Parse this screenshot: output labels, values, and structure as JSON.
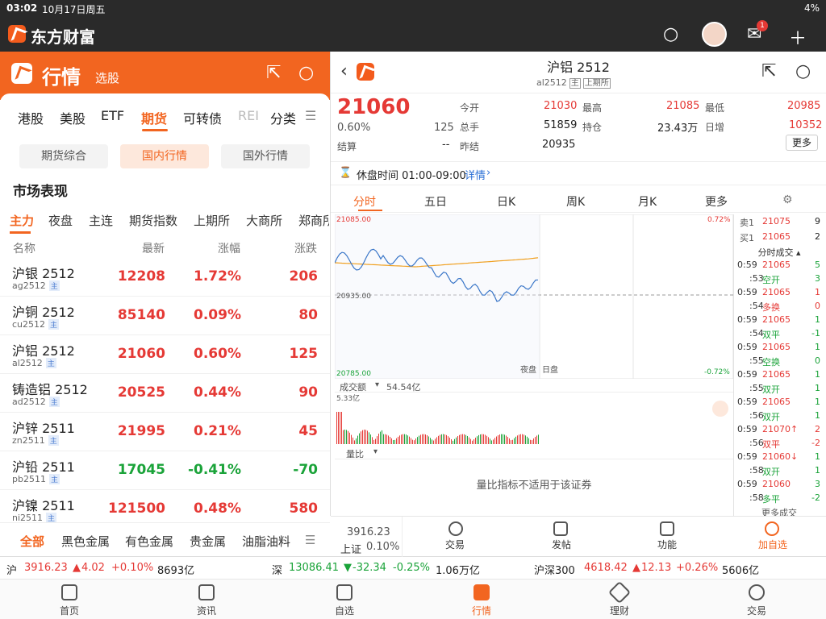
{
  "status": {
    "time": "03:02",
    "date": "10月17日周五",
    "battery": "4%"
  },
  "app": {
    "title": "东方财富",
    "mail_badge": "1"
  },
  "left": {
    "header_title": "行情",
    "header_sub": "选股",
    "tabs": [
      "港股",
      "美股",
      "ETF",
      "期货",
      "可转债",
      "REI",
      "分类"
    ],
    "segments": [
      "期货综合",
      "国内行情",
      "国外行情"
    ],
    "section_title": "市场表现",
    "subtabs": [
      "主力",
      "夜盘",
      "主连",
      "期货指数",
      "上期所",
      "大商所",
      "郑商所"
    ],
    "columns": [
      "名称",
      "最新",
      "涨幅",
      "涨跌"
    ],
    "rows": [
      {
        "name": "沪银 2512",
        "code": "ag2512",
        "tag": "主",
        "last": "12208",
        "pct": "1.72%",
        "chg": "206",
        "dir": "up"
      },
      {
        "name": "沪铜 2512",
        "code": "cu2512",
        "tag": "主",
        "last": "85140",
        "pct": "0.09%",
        "chg": "80",
        "dir": "up"
      },
      {
        "name": "沪铝 2512",
        "code": "al2512",
        "tag": "主",
        "last": "21060",
        "pct": "0.60%",
        "chg": "125",
        "dir": "up"
      },
      {
        "name": "铸造铝 2512",
        "code": "ad2512",
        "tag": "主",
        "last": "20525",
        "pct": "0.44%",
        "chg": "90",
        "dir": "up"
      },
      {
        "name": "沪锌 2511",
        "code": "zn2511",
        "tag": "主",
        "last": "21995",
        "pct": "0.21%",
        "chg": "45",
        "dir": "up"
      },
      {
        "name": "沪铅 2511",
        "code": "pb2511",
        "tag": "主",
        "last": "17045",
        "pct": "-0.41%",
        "chg": "-70",
        "dir": "dn"
      },
      {
        "name": "沪镍 2511",
        "code": "ni2511",
        "tag": "主",
        "last": "121500",
        "pct": "0.48%",
        "chg": "580",
        "dir": "up"
      }
    ],
    "categories": [
      "全部",
      "黑色金属",
      "有色金属",
      "贵金属",
      "油脂油料"
    ]
  },
  "ticker": [
    {
      "mk": "沪",
      "val": "3916.23",
      "chg": "4.02",
      "pct": "+0.10%",
      "amt": "8693亿",
      "dir": "up"
    },
    {
      "mk": "深",
      "val": "13086.41",
      "chg": "-32.34",
      "pct": "-0.25%",
      "amt": "1.06万亿",
      "dir": "dn"
    },
    {
      "mk": "沪深300",
      "val": "4618.42",
      "chg": "12.13",
      "pct": "+0.26%",
      "amt": "5606亿",
      "dir": "up"
    }
  ],
  "nav": [
    "首页",
    "资讯",
    "自选",
    "行情",
    "理财",
    "交易"
  ],
  "right": {
    "title": "沪铝 2512",
    "code": "al2512",
    "tag1": "主",
    "tag2": "上期所",
    "price": "21060",
    "pct": "0.60%",
    "chg": "125",
    "q": [
      {
        "l": "今开",
        "v": "21030",
        "c": "up"
      },
      {
        "l": "最高",
        "v": "21085",
        "c": "up"
      },
      {
        "l": "最低",
        "v": "20985",
        "c": "up"
      },
      {
        "l": "总手",
        "v": "51859",
        "c": ""
      },
      {
        "l": "持仓",
        "v": "23.43万",
        "c": ""
      },
      {
        "l": "日增",
        "v": "10352",
        "c": "up"
      },
      {
        "l": "结算",
        "v": "--",
        "c": ""
      },
      {
        "l": "昨结",
        "v": "20935",
        "c": ""
      }
    ],
    "more": "更多",
    "pause": "休盘时间 01:00-09:00",
    "detail": "详情",
    "ctabs": [
      "分时",
      "五日",
      "日K",
      "周K",
      "月K",
      "更多"
    ],
    "chart_top": "21085.00",
    "chart_mid": "20935.00",
    "chart_bot": "20785.00",
    "chart_pct_top": "0.72%",
    "chart_pct_bot": "-0.72%",
    "night": "夜盘",
    "day": "日盘",
    "vol_label": "成交额",
    "vol_val": "54.54亿",
    "vol_max": "5.33亿",
    "lb_label": "量比",
    "lb_msg": "量比指标不适用于该证券",
    "sell1": {
      "l": "卖1",
      "p": "21075",
      "v": "9"
    },
    "buy1": {
      "l": "买1",
      "p": "21065",
      "v": "2"
    },
    "trades_title": "分时成交",
    "trades": [
      {
        "t": "0:59",
        "p": "21065",
        "v": "5",
        "c": "dn"
      },
      {
        "t": ":53",
        "p": "空开",
        "v": "3",
        "c": "dn"
      },
      {
        "t": "0:59",
        "p": "21065",
        "v": "1",
        "c": "up"
      },
      {
        "t": ":54",
        "p": "多换",
        "v": "0",
        "c": "up"
      },
      {
        "t": "0:59",
        "p": "21065",
        "v": "1",
        "c": "dn"
      },
      {
        "t": ":54",
        "p": "双平",
        "v": "-1",
        "c": "dn"
      },
      {
        "t": "0:59",
        "p": "21065",
        "v": "1",
        "c": "dn"
      },
      {
        "t": ":55",
        "p": "空换",
        "v": "0",
        "c": "dn"
      },
      {
        "t": "0:59",
        "p": "21065",
        "v": "1",
        "c": "dn"
      },
      {
        "t": ":55",
        "p": "双开",
        "v": "1",
        "c": "dn"
      },
      {
        "t": "0:59",
        "p": "21065",
        "v": "1",
        "c": "dn"
      },
      {
        "t": ":56",
        "p": "双开",
        "v": "1",
        "c": "dn"
      },
      {
        "t": "0:59",
        "p": "21070↑",
        "v": "2",
        "c": "up"
      },
      {
        "t": ":56",
        "p": "双平",
        "v": "-2",
        "c": "up"
      },
      {
        "t": "0:59",
        "p": "21060↓",
        "v": "1",
        "c": "dn"
      },
      {
        "t": ":58",
        "p": "双开",
        "v": "1",
        "c": "dn"
      },
      {
        "t": "0:59",
        "p": "21060",
        "v": "3",
        "c": "dn"
      },
      {
        "t": ":58",
        "p": "多平",
        "v": "-2",
        "c": "dn"
      }
    ],
    "more_trades": "更多成交",
    "bar_index": "3916.23",
    "bar_index_name": "上证",
    "bar_index_pct": "0.10%",
    "actions": [
      "交易",
      "发帖",
      "功能",
      "加自选"
    ]
  }
}
